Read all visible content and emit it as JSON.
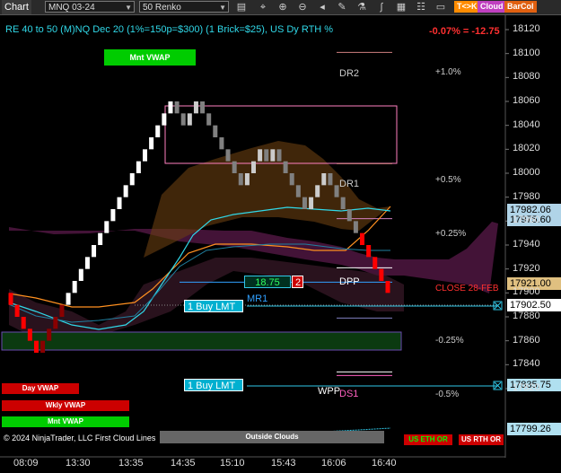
{
  "toolbar": {
    "title": "Chart",
    "instrument": "MNQ 03-24",
    "bar_type": "50 Renko",
    "tag_tk": "T<>K",
    "tag_cloud": "Cloud",
    "tag_barcol": "BarCol"
  },
  "chart": {
    "header": "RE 40 to 50 (M)NQ Dec 20 (1%=150p=$300) (1 Brick=$25), US Dy RTH %",
    "change": "-0.07% = -12.75",
    "mnt_vwap_top": "Mnt VWAP",
    "left_labels": [
      "Day VWAP",
      "Wkly VWAP",
      "Mnt VWAP"
    ],
    "footer_text": "© 2024 NinjaTrader, LLC",
    "first_cloud_lines": "First Cloud Lines",
    "outside_clouds": "Outside Clouds",
    "us_eth_or": "US ETH OR",
    "us_rth_or": "US RTH OR",
    "order_value": "18.75",
    "order_qty": "2",
    "buy_lmt_1": "1 Buy LMT",
    "buy_lmt_2": "1 Buy LMT",
    "close_label": "CLOSE 28-FEB",
    "colors": {
      "up": "#ffffff",
      "down": "#ff0000",
      "neutral": "#808080",
      "accent": "#00ffff"
    }
  },
  "levels": [
    {
      "name": "DR2",
      "price": 18101,
      "pct": "+1.0%"
    },
    {
      "name": "DR1",
      "price": 18008,
      "pct": "+0.5%"
    },
    {
      "name": "",
      "price": 17962,
      "pct": "+0.25%"
    },
    {
      "name": "DPP",
      "price": 17921,
      "pct": ""
    },
    {
      "name": "MR1",
      "price": 17909,
      "pct": ""
    },
    {
      "name": "",
      "price": 17879,
      "pct": "-0.25%"
    },
    {
      "name": "WPP",
      "price": 17834,
      "pct": ""
    },
    {
      "name": "DS1",
      "price": 17831,
      "pct": "-0.5%"
    }
  ],
  "price_tags": [
    {
      "price": 17982.06,
      "label": "17982.06",
      "bg": "#b0d4e8",
      "fg": "#000"
    },
    {
      "price": 17975.6,
      "label": "17975.60",
      "bg": "#b0d4e8",
      "fg": "#000"
    },
    {
      "price": 17921.0,
      "label": "17921.00",
      "bg": "#e0c080",
      "fg": "#000"
    },
    {
      "price": 17902.5,
      "label": "17902.50",
      "bg": "#ffffff",
      "fg": "#000"
    },
    {
      "price": 17835.75,
      "label": "17835.75",
      "bg": "#b0e0f0",
      "fg": "#000"
    },
    {
      "price": 17799.26,
      "label": "17799.26",
      "bg": "#b0e0f0",
      "fg": "#000"
    }
  ],
  "chart_data": {
    "type": "candlestick",
    "y_axis_ticks": [
      18120,
      18100,
      18080,
      18060,
      18040,
      18020,
      18000,
      17980,
      17960,
      17940,
      17920,
      17900,
      17880,
      17860,
      17840,
      17820
    ],
    "ylim": [
      17795,
      18130
    ],
    "x_ticks": [
      "08:09",
      "13:30",
      "13:35",
      "14:35",
      "15:10",
      "15:43",
      "16:06",
      "16:40"
    ],
    "bricks": [
      {
        "o": 17900,
        "c": 17890,
        "dir": "down"
      },
      {
        "o": 17890,
        "c": 17880,
        "dir": "down"
      },
      {
        "o": 17880,
        "c": 17870,
        "dir": "down"
      },
      {
        "o": 17870,
        "c": 17860,
        "dir": "down"
      },
      {
        "o": 17860,
        "c": 17850,
        "dir": "down"
      },
      {
        "o": 17850,
        "c": 17860,
        "dir": "up"
      },
      {
        "o": 17860,
        "c": 17870,
        "dir": "up"
      },
      {
        "o": 17870,
        "c": 17880,
        "dir": "up"
      },
      {
        "o": 17880,
        "c": 17890,
        "dir": "up"
      },
      {
        "o": 17890,
        "c": 17900,
        "dir": "up"
      },
      {
        "o": 17900,
        "c": 17910,
        "dir": "up"
      },
      {
        "o": 17910,
        "c": 17920,
        "dir": "up"
      },
      {
        "o": 17920,
        "c": 17930,
        "dir": "up"
      },
      {
        "o": 17930,
        "c": 17940,
        "dir": "up"
      },
      {
        "o": 17940,
        "c": 17950,
        "dir": "up"
      },
      {
        "o": 17950,
        "c": 17960,
        "dir": "up"
      },
      {
        "o": 17960,
        "c": 17970,
        "dir": "up"
      },
      {
        "o": 17970,
        "c": 17980,
        "dir": "up"
      },
      {
        "o": 17980,
        "c": 17990,
        "dir": "up"
      },
      {
        "o": 17990,
        "c": 18000,
        "dir": "up"
      },
      {
        "o": 18000,
        "c": 18010,
        "dir": "up"
      },
      {
        "o": 18010,
        "c": 18020,
        "dir": "up"
      },
      {
        "o": 18020,
        "c": 18030,
        "dir": "up"
      },
      {
        "o": 18030,
        "c": 18040,
        "dir": "up"
      },
      {
        "o": 18040,
        "c": 18050,
        "dir": "up"
      },
      {
        "o": 18050,
        "c": 18060,
        "dir": "up"
      },
      {
        "o": 18060,
        "c": 18050,
        "dir": "down"
      },
      {
        "o": 18050,
        "c": 18040,
        "dir": "down"
      },
      {
        "o": 18040,
        "c": 18050,
        "dir": "up"
      },
      {
        "o": 18050,
        "c": 18060,
        "dir": "up"
      },
      {
        "o": 18060,
        "c": 18050,
        "dir": "down"
      },
      {
        "o": 18050,
        "c": 18040,
        "dir": "down"
      },
      {
        "o": 18040,
        "c": 18030,
        "dir": "down"
      },
      {
        "o": 18030,
        "c": 18020,
        "dir": "down"
      },
      {
        "o": 18020,
        "c": 18010,
        "dir": "down"
      },
      {
        "o": 18010,
        "c": 18000,
        "dir": "down"
      },
      {
        "o": 18000,
        "c": 17990,
        "dir": "down"
      },
      {
        "o": 17990,
        "c": 18000,
        "dir": "up"
      },
      {
        "o": 18000,
        "c": 18010,
        "dir": "up"
      },
      {
        "o": 18010,
        "c": 18020,
        "dir": "up"
      },
      {
        "o": 18020,
        "c": 18010,
        "dir": "down"
      },
      {
        "o": 18010,
        "c": 18020,
        "dir": "up"
      },
      {
        "o": 18020,
        "c": 18010,
        "dir": "down"
      },
      {
        "o": 18010,
        "c": 18000,
        "dir": "down"
      },
      {
        "o": 18000,
        "c": 17990,
        "dir": "down"
      },
      {
        "o": 17990,
        "c": 17980,
        "dir": "down"
      },
      {
        "o": 17980,
        "c": 17970,
        "dir": "down"
      },
      {
        "o": 17970,
        "c": 17980,
        "dir": "up"
      },
      {
        "o": 17980,
        "c": 17990,
        "dir": "up"
      },
      {
        "o": 17990,
        "c": 18000,
        "dir": "up"
      },
      {
        "o": 18000,
        "c": 17990,
        "dir": "down"
      },
      {
        "o": 17990,
        "c": 17980,
        "dir": "down"
      },
      {
        "o": 17980,
        "c": 17970,
        "dir": "down"
      },
      {
        "o": 17970,
        "c": 17960,
        "dir": "down"
      },
      {
        "o": 17960,
        "c": 17950,
        "dir": "down"
      },
      {
        "o": 17950,
        "c": 17940,
        "dir": "down"
      },
      {
        "o": 17940,
        "c": 17930,
        "dir": "down"
      },
      {
        "o": 17930,
        "c": 17920,
        "dir": "down"
      },
      {
        "o": 17920,
        "c": 17910,
        "dir": "down"
      },
      {
        "o": 17910,
        "c": 17900,
        "dir": "down"
      }
    ]
  }
}
